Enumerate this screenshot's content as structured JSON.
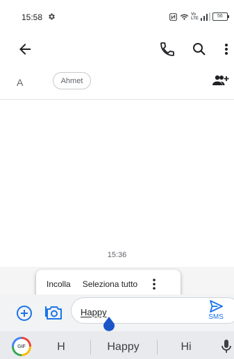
{
  "status_bar": {
    "time": "15:58",
    "battery_level": "56",
    "network_label": "LTE",
    "network_label_top": "Vo",
    "icons": [
      "settings-gear-icon",
      "nfc-icon",
      "wifi-icon",
      "signal-icon",
      "battery-icon"
    ]
  },
  "app_bar": {
    "icons": [
      "back-arrow-icon",
      "phone-icon",
      "search-icon",
      "more-vertical-icon"
    ]
  },
  "recipients": {
    "prefix": "A",
    "chips": [
      "Ahmet"
    ],
    "add_icon": "add-people-icon"
  },
  "conversation": {
    "timestamp": "15:36"
  },
  "context_menu": {
    "items": [
      "Incolla",
      "Seleziona tutto"
    ],
    "more_icon": "more-vertical-icon"
  },
  "compose": {
    "text": "Happy",
    "send_label": "SMS",
    "icons": [
      "add-circle-icon",
      "camera-icon",
      "send-icon"
    ],
    "accent_color": "#1a73e8"
  },
  "keyboard": {
    "gif_label": "GIF",
    "suggestions": [
      "H",
      "Happy",
      "Hi"
    ],
    "mic_icon": "microphone-icon"
  }
}
